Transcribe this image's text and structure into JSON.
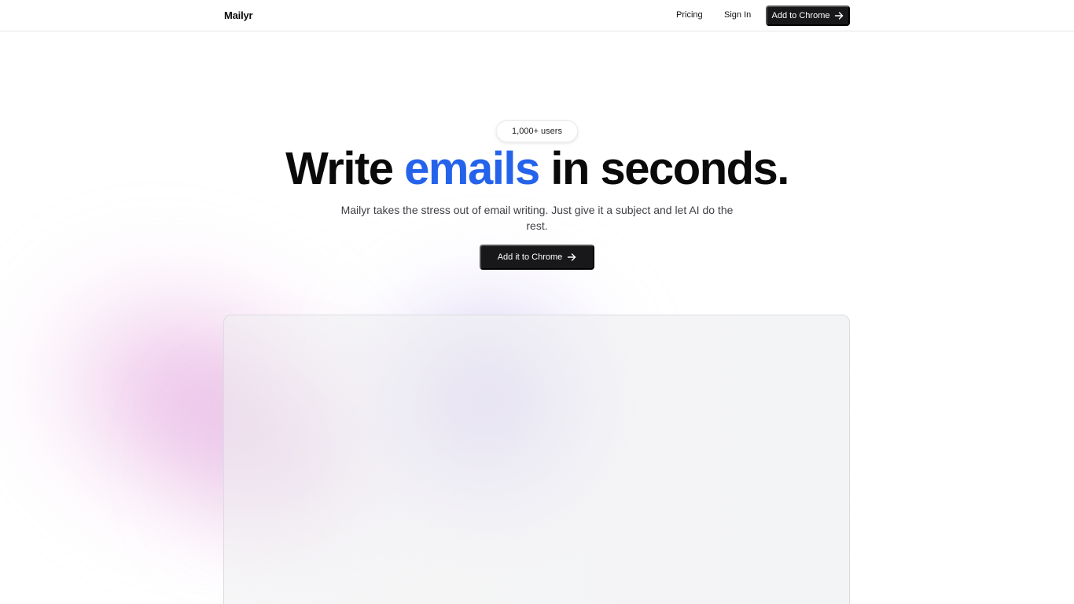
{
  "header": {
    "logo": "Mailyr",
    "nav": {
      "pricing": "Pricing",
      "sign_in": "Sign In"
    },
    "cta_label": "Add to Chrome",
    "cta_icon": "arrow-right-icon"
  },
  "hero": {
    "badge": "1,000+ users",
    "headline": {
      "before": "Write ",
      "accent": "emails",
      "after": " in seconds."
    },
    "subtitle": "Mailyr takes the stress out of email writing. Just give it a subject and let AI do the rest.",
    "cta_label": "Add it to Chrome",
    "cta_icon": "arrow-right-icon"
  },
  "colors": {
    "accent": "#2563eb",
    "button_bg": "#18181b",
    "text": "#0a0a0a",
    "muted_text": "#3f3f46",
    "blob_pink": "#e2a0dc",
    "blob_purple": "#beaaeb"
  }
}
